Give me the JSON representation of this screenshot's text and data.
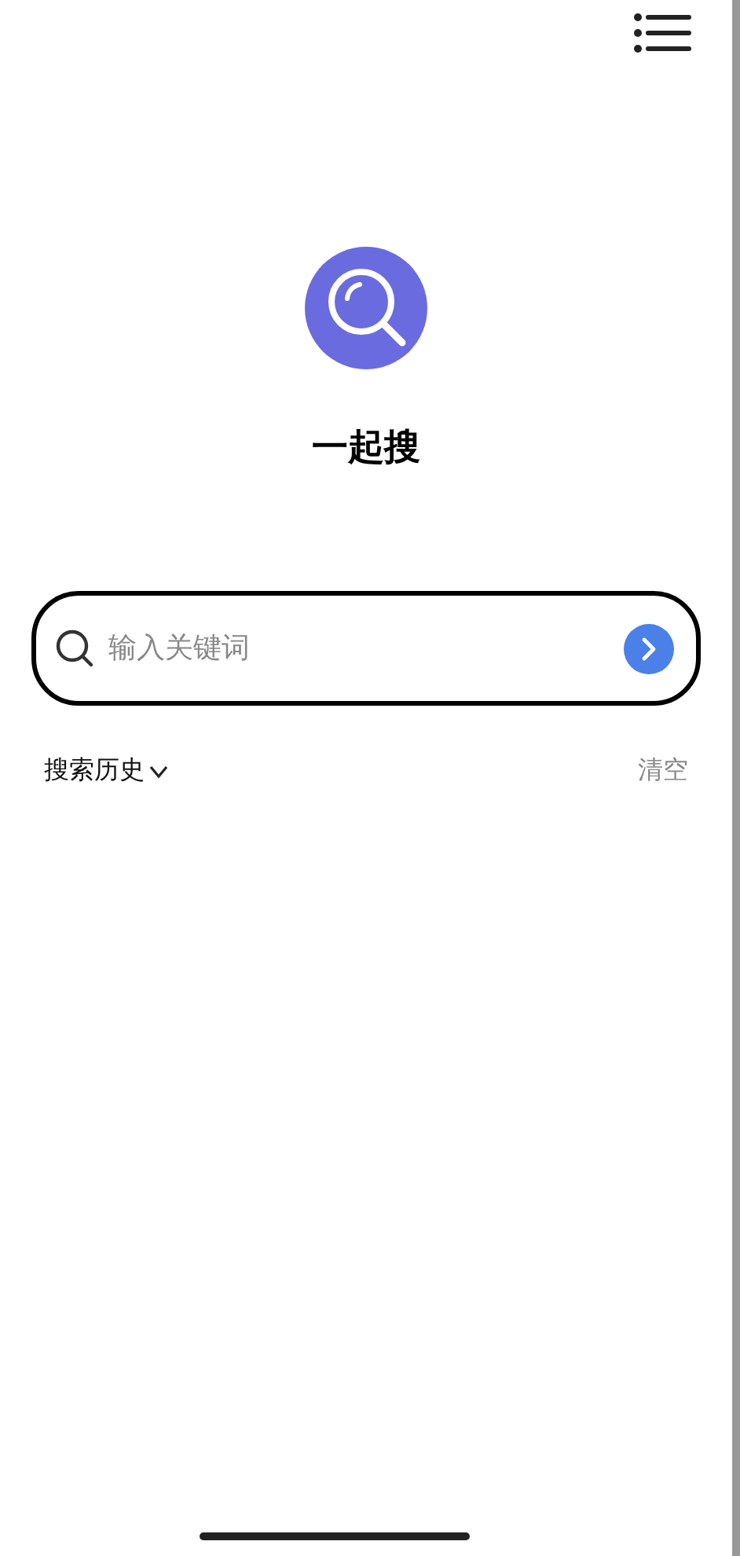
{
  "app": {
    "title": "一起搜"
  },
  "search": {
    "placeholder": "输入关键词"
  },
  "history": {
    "label": "搜索历史",
    "expanded": true,
    "clear": "清空"
  }
}
